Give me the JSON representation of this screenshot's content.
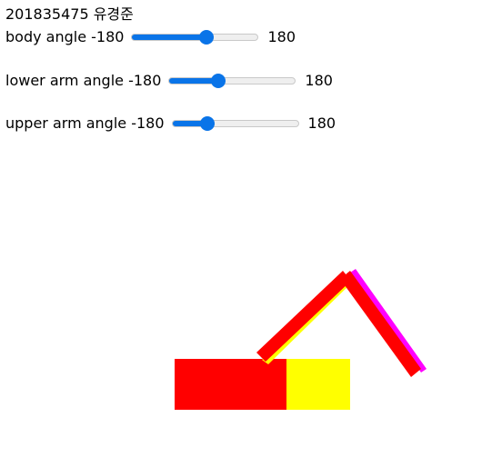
{
  "header": {
    "student_id": "201835475 유경준"
  },
  "sliders": [
    {
      "id": "body",
      "label": "body angle -180",
      "max_label": "180",
      "min": -180,
      "max": 180,
      "value": 38
    },
    {
      "id": "lower",
      "label": "lower arm angle -180",
      "max_label": "180",
      "min": -180,
      "max": 180,
      "value": -45
    },
    {
      "id": "upper",
      "label": "upper arm angle -180",
      "max_label": "180",
      "min": -180,
      "max": 180,
      "value": -90
    }
  ],
  "colors": {
    "body_front": "#ff0000",
    "body_side": "#ffff00",
    "lower_arm": "#ff0000",
    "lower_arm_edge": "#ffff00",
    "upper_arm": "#ff0000",
    "upper_arm_edge": "#ff00ff",
    "slider_accent": "#0a74e8"
  }
}
